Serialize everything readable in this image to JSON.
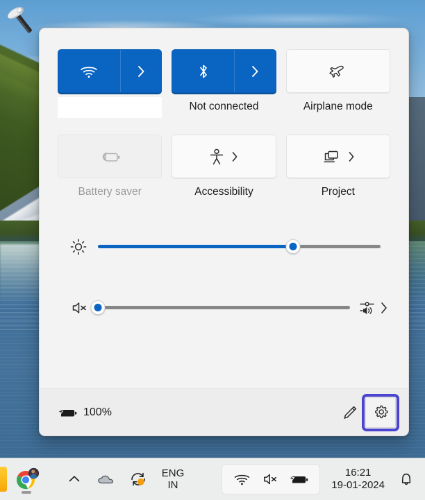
{
  "desktop": {
    "wallpaper_description": "mountain lake landscape with blue sky, green hillside and snowy peak",
    "icons": [
      {
        "name": "tools-hammer-icon",
        "label": ""
      }
    ]
  },
  "quick_settings": {
    "tiles": [
      {
        "id": "wifi",
        "label": "",
        "label_blank": true,
        "state": "on",
        "icon": "wifi-icon",
        "has_chevron": true,
        "chevron_split": true
      },
      {
        "id": "bluetooth",
        "label": "Not connected",
        "label_blank": false,
        "state": "on",
        "icon": "bluetooth-icon",
        "has_chevron": true,
        "chevron_split": true
      },
      {
        "id": "airplane-mode",
        "label": "Airplane mode",
        "label_blank": false,
        "state": "off",
        "icon": "airplane-icon",
        "has_chevron": false,
        "chevron_split": false
      },
      {
        "id": "battery-saver",
        "label": "Battery saver",
        "label_blank": false,
        "state": "disabled",
        "icon": "battery-saver-icon",
        "has_chevron": false,
        "chevron_split": false
      },
      {
        "id": "accessibility",
        "label": "Accessibility",
        "label_blank": false,
        "state": "off",
        "icon": "accessibility-icon",
        "has_chevron": true,
        "chevron_split": false
      },
      {
        "id": "project",
        "label": "Project",
        "label_blank": false,
        "state": "off",
        "icon": "project-icon",
        "has_chevron": true,
        "chevron_split": false
      }
    ],
    "sliders": [
      {
        "id": "brightness",
        "icon": "brightness-icon",
        "value": 69,
        "min": 0,
        "max": 100,
        "has_tail": false
      },
      {
        "id": "volume",
        "icon": "volume-muted-icon",
        "value": 0,
        "min": 0,
        "max": 100,
        "has_tail": true,
        "tail_icon": "audio-output-selector-icon"
      }
    ],
    "footer": {
      "battery_icon": "battery-charging-icon",
      "battery_percent": "100%",
      "edit_icon": "pencil-edit-icon",
      "settings_icon": "gear-settings-icon",
      "settings_focused": true
    }
  },
  "taskbar": {
    "apps": [
      {
        "id": "pinned-edge-app",
        "icon": "orange-app-icon",
        "running": false
      },
      {
        "id": "chrome",
        "icon": "chrome-icon",
        "running": true,
        "badge": "profile-avatar-badge"
      }
    ],
    "tray": [
      {
        "id": "show-hidden-icons",
        "icon": "chevron-up-icon"
      },
      {
        "id": "onedrive",
        "icon": "cloud-icon"
      },
      {
        "id": "sync",
        "icon": "sync-arrows-icon",
        "badge_color": "#f59e0b"
      }
    ],
    "language": {
      "line1": "ENG",
      "line2": "IN"
    },
    "status_pill": {
      "icons": [
        "wifi-icon",
        "volume-muted-icon",
        "battery-charging-icon"
      ]
    },
    "clock": {
      "time": "16:21",
      "date": "19-01-2024"
    },
    "notifications_icon": "bell-icon"
  },
  "colors": {
    "accent_blue": "#0a64c2",
    "panel_bg": "#f3f3f3",
    "footer_bg": "#ededed",
    "focus_highlight": "#4a44ce",
    "slider_track": "#868686",
    "disabled_text": "#9b9b9b",
    "taskbar_bg": "#eceded"
  }
}
